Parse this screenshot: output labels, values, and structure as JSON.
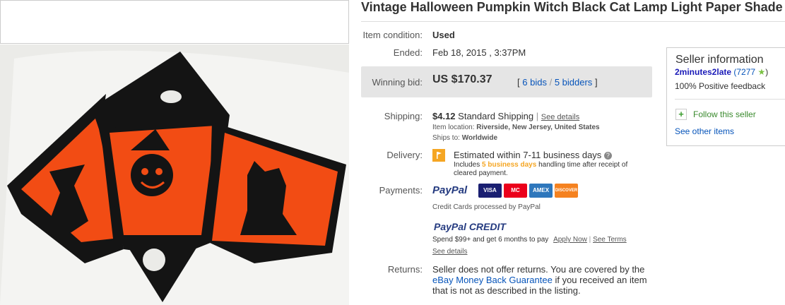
{
  "listing": {
    "title": "Vintage Halloween Pumpkin Witch Black Cat Lamp Light Paper Shade",
    "condition_label": "Item condition:",
    "condition_value": "Used",
    "ended_label": "Ended:",
    "ended_value": "Feb 18, 2015 , 3:37PM",
    "winning_bid_label": "Winning bid:",
    "winning_bid_value": "US $170.37",
    "bids_open": "[",
    "bids_link": "6 bids",
    "bidders_sep": "/",
    "bidders_link": "5 bidders",
    "bids_close": "]"
  },
  "shipping": {
    "label": "Shipping:",
    "cost": "$4.12",
    "method": "Standard Shipping",
    "sep": "|",
    "details_link": "See details",
    "location_label": "Item location:",
    "location_value": "Riverside, New Jersey, United States",
    "ships_to_label": "Ships to:",
    "ships_to_value": "Worldwide"
  },
  "delivery": {
    "label": "Delivery:",
    "estimate": "Estimated within 7-11 business days",
    "note_prefix": "Includes",
    "note_highlight": "5 business days",
    "note_suffix": "handling time after receipt of",
    "note_line2": "cleared payment."
  },
  "payments": {
    "label": "Payments:",
    "paypal_logo": "PayPal",
    "cards": [
      {
        "name": "VISA",
        "color": "#1a1f71"
      },
      {
        "name": "MC",
        "color": "#eb001b"
      },
      {
        "name": "AMEX",
        "color": "#2e77bc"
      },
      {
        "name": "DISCOVER",
        "color": "#f58220"
      }
    ],
    "processed_note": "Credit Cards processed by PayPal",
    "credit_logo": "PayPal CREDIT",
    "credit_text": "Spend $99+ and get 6 months to pay",
    "apply_link": "Apply Now",
    "sep": "|",
    "terms_link": "See Terms",
    "details_link": "See details"
  },
  "returns": {
    "label": "Returns:",
    "line1": "Seller does not offer returns. You are covered by the",
    "guarantee_link": "eBay Money Back Guarantee",
    "line2_suffix": "if you received an item",
    "line3": "that is not as described in the listing."
  },
  "seller": {
    "heading": "Seller information",
    "name": "2minutes2late",
    "feedback_score": "(7277",
    "feedback_close": ")",
    "positive": "100% Positive feedback",
    "follow": "Follow this seller",
    "see_other": "See other items"
  },
  "colors": {
    "link": "#0654ba",
    "shade_orange": "#f24c14",
    "shade_black": "#141414",
    "highlight": "#f5a623",
    "seller_link": "#1a1ab8"
  }
}
